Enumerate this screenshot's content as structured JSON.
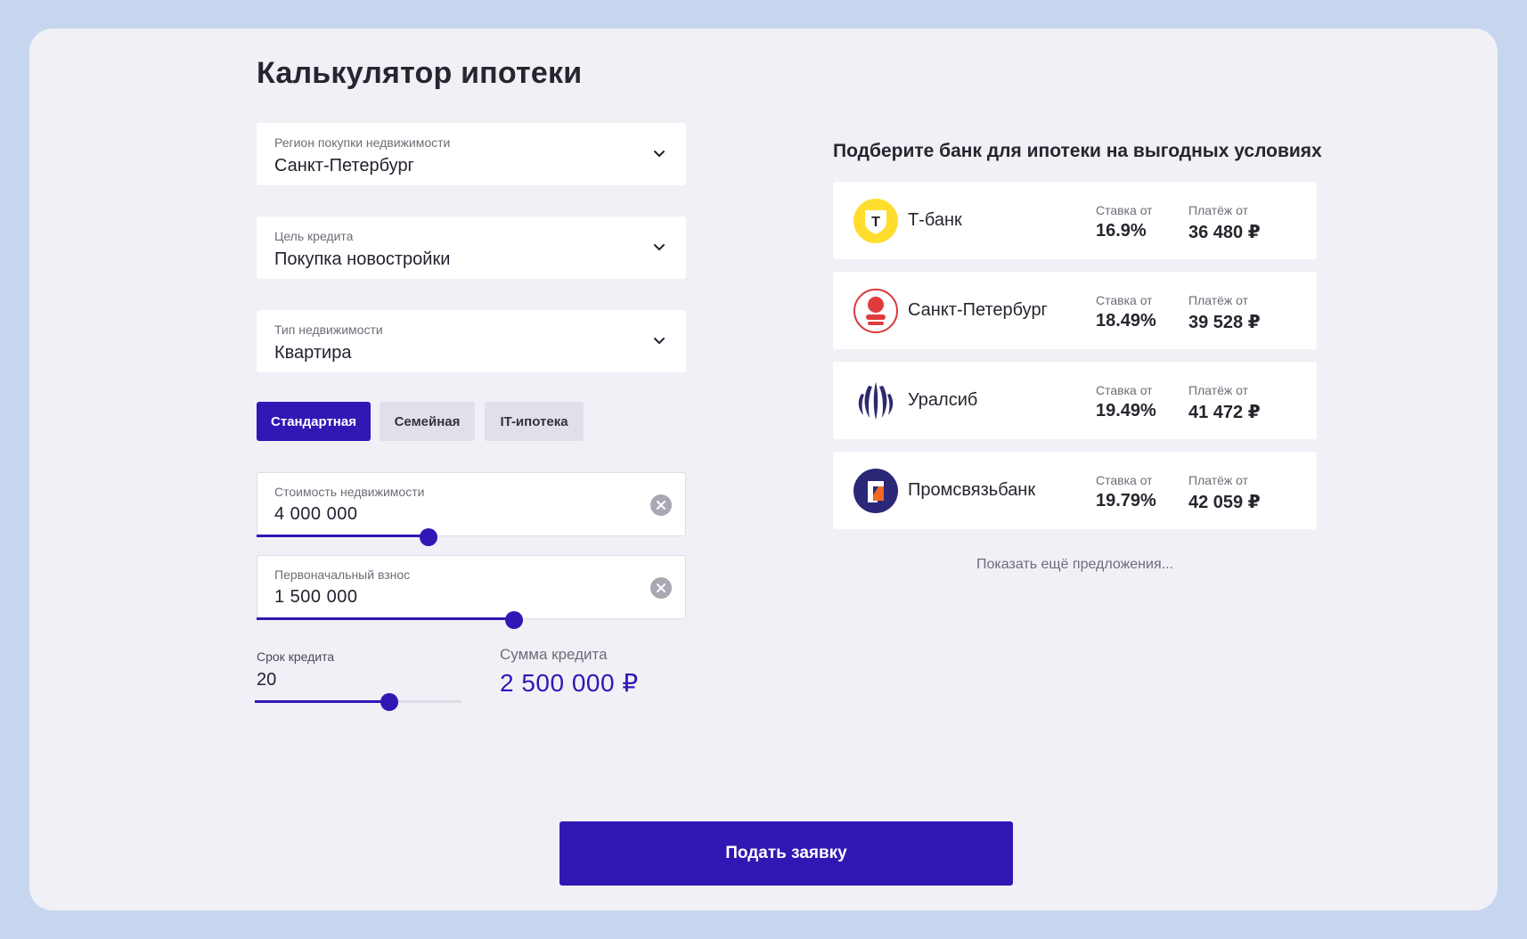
{
  "page": {
    "title": "Калькулятор ипотеки"
  },
  "colors": {
    "accent": "#2f18b4",
    "background": "#c6d6ef",
    "card": "#f0f0f6"
  },
  "selects": [
    {
      "label": "Регион покупки недвижимости",
      "value": "Санкт-Петербург",
      "icon": "chevron-down-icon"
    },
    {
      "label": "Цель кредита",
      "value": "Покупка новостройки",
      "icon": "chevron-down-icon"
    },
    {
      "label": "Тип недвижимости",
      "value": "Квартира",
      "icon": "chevron-down-icon"
    }
  ],
  "tabs": [
    {
      "label": "Стандартная",
      "active": true
    },
    {
      "label": "Семейная",
      "active": false
    },
    {
      "label": "IT-ипотека",
      "active": false
    }
  ],
  "fields": {
    "price": {
      "label": "Стоимость недвижимости",
      "value": "4 000 000",
      "slider_fraction": 0.4
    },
    "down_payment": {
      "label": "Первоначальный взнос",
      "value": "1 500 000",
      "slider_fraction": 0.6
    }
  },
  "term": {
    "label": "Срок кредита",
    "value": "20",
    "slider_fraction": 0.65
  },
  "loan_sum": {
    "label": "Сумма кредита",
    "value": "2 500 000 ₽"
  },
  "banks": {
    "heading": "Подберите банк для ипотеки на выгодных условиях",
    "items": [
      {
        "name": "Т-банк",
        "rate_label": "Ставка от",
        "rate": "16.9%",
        "payment_label": "Платёж от",
        "payment": "36 480 ₽",
        "logo": "tbank-logo-icon",
        "logo_text": "Т"
      },
      {
        "name": "Санкт-Петербург",
        "rate_label": "Ставка от",
        "rate": "18.49%",
        "payment_label": "Платёж от",
        "payment": "39 528 ₽",
        "logo": "bspb-logo-icon"
      },
      {
        "name": "Уралсиб",
        "rate_label": "Ставка от",
        "rate": "19.49%",
        "payment_label": "Платёж от",
        "payment": "41 472 ₽",
        "logo": "uralsib-logo-icon"
      },
      {
        "name": "Промсвязьбанк",
        "rate_label": "Ставка от",
        "rate": "19.79%",
        "payment_label": "Платёж от",
        "payment": "42 059 ₽",
        "logo": "psb-logo-icon"
      }
    ],
    "more_label": "Показать ещё предложения..."
  },
  "submit_label": "Подать заявку"
}
